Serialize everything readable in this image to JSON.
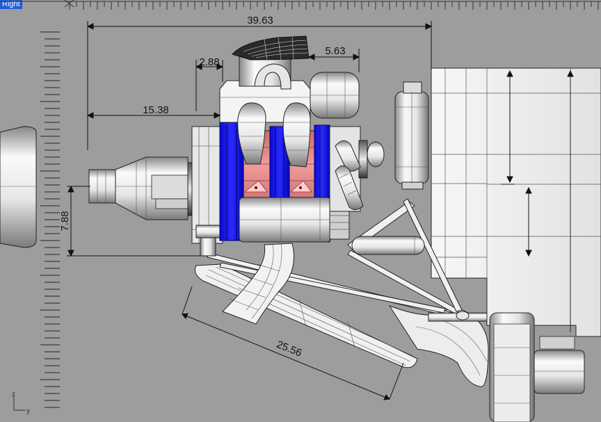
{
  "viewport": {
    "label": "Right",
    "background": "#9d9d9d",
    "label_color": "#1f5fd6"
  },
  "dimensions": {
    "overall_width": "39.63",
    "top_offset": "2.88",
    "intake_width": "5.63",
    "left_offset": "15.38",
    "height": "7.88",
    "diagonal": "25.56"
  },
  "axes": {
    "vertical": "z",
    "horizontal": "y"
  },
  "colors": {
    "engine_blue": "#1111ee",
    "engine_pink": "#e88f8f",
    "model_light": "#f2f2f2",
    "wire": "#333333"
  }
}
